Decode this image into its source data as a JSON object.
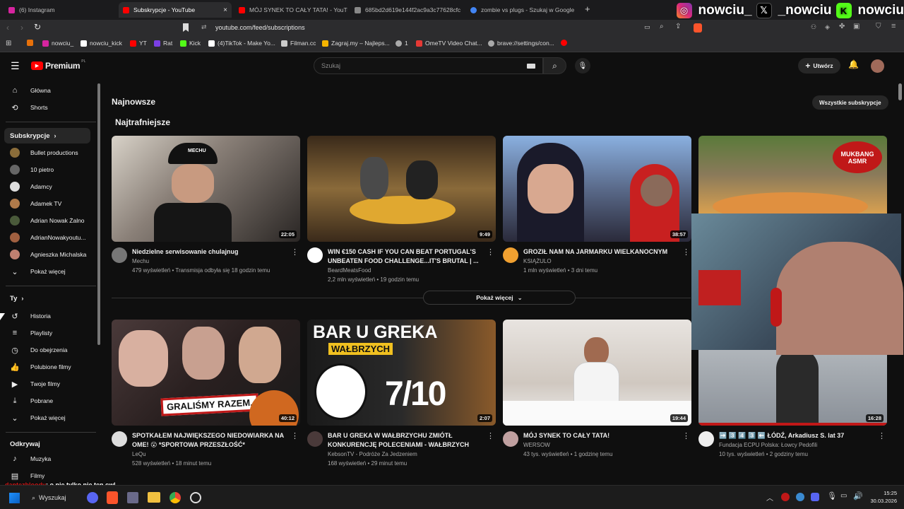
{
  "browser": {
    "tabs": [
      {
        "label": "(6) Instagram",
        "color": "#d6249f"
      },
      {
        "label": "Subskrypcje - YouTube",
        "color": "#ff0000",
        "close": "×"
      },
      {
        "label": "MÓJ SYNEK TO CAŁY TATA! - YouTube",
        "color": "#ff0000"
      },
      {
        "label": "685bd2d619e144f2ac9a3c77628cfc",
        "color": "#888888"
      },
      {
        "label": "zombie vs plugs - Szukaj w Google",
        "color": "#4285f4"
      }
    ],
    "new_tab": "+",
    "url": "youtube.com/feed/subscriptions",
    "bookmarks": [
      {
        "label": "",
        "color": "#e8710a"
      },
      {
        "label": "nowciu_",
        "color": "#d6249f"
      },
      {
        "label": "nowciu_kick",
        "color": "#ffffff"
      },
      {
        "label": "YT",
        "color": "#ff0000"
      },
      {
        "label": "Rat",
        "color": "#7b3fe4"
      },
      {
        "label": "Kick",
        "color": "#53fc18"
      },
      {
        "label": "(4)TikTok - Make Yo...",
        "color": "#ffffff"
      },
      {
        "label": "Filman.cc",
        "color": "#cccccc"
      },
      {
        "label": "Zagraj.my – Najleps...",
        "color": "#f4b400"
      },
      {
        "label": "1",
        "color": "#aaaaaa"
      },
      {
        "label": "OmeTV Video Chat...",
        "color": "#e53935"
      },
      {
        "label": "brave://settings/con...",
        "color": "#aaaaaa"
      }
    ]
  },
  "overlay": {
    "instagram": "nowciu_",
    "x": "_nowciu",
    "kick": "nowciu",
    "kick_letter": "K"
  },
  "youtube": {
    "logo": "Premium",
    "logo_sup": "PL",
    "search_placeholder": "Szukaj",
    "create_label": "Utwórz",
    "sidebar": {
      "main": [
        {
          "label": "Główna",
          "icon": "⌂"
        },
        {
          "label": "Shorts",
          "icon": "⟲"
        }
      ],
      "subs_header": "Subskrypcje",
      "subs": [
        {
          "label": "Bullet productions",
          "color": "#8b6d3a"
        },
        {
          "label": "10 pietro",
          "color": "#666666"
        },
        {
          "label": "Adamcy",
          "color": "#dddddd"
        },
        {
          "label": "Adamek TV",
          "color": "#b07a4a"
        },
        {
          "label": "Adrian Nowak Żalno",
          "color": "#4a5a3a"
        },
        {
          "label": "AdrianNowakyoutu...",
          "color": "#a06040"
        },
        {
          "label": "Agnieszka Michalska",
          "color": "#c08070"
        }
      ],
      "show_more": "Pokaż więcej",
      "you_header": "Ty",
      "you": [
        {
          "label": "Historia",
          "icon": "↺"
        },
        {
          "label": "Playlisty",
          "icon": "≡"
        },
        {
          "label": "Do obejrzenia",
          "icon": "◷"
        },
        {
          "label": "Polubione filmy",
          "icon": "👍"
        },
        {
          "label": "Twoje filmy",
          "icon": "▶"
        },
        {
          "label": "Pobrane",
          "icon": "⤓"
        }
      ],
      "show_more2": "Pokaż więcej",
      "explore_header": "Odkrywaj",
      "explore": [
        {
          "label": "Muzyka",
          "icon": "♪"
        },
        {
          "label": "Filmy",
          "icon": "▤"
        }
      ]
    },
    "section_title": "Najnowsze",
    "all_subs": "Wszystkie subskrypcje",
    "subsection_title": "Najtrafniejsze",
    "show_more_center": "Pokaż więcej",
    "videos": [
      {
        "title": "Niedzielne serwisowanie chulajnug",
        "channel": "Mechu",
        "meta": "479 wyświetleń • Transmisja odbyła się 18 godzin temu",
        "duration": "22:05",
        "thumb": "#5a5250",
        "avatar": "#777777"
      },
      {
        "title": "WIN €150 CASH IF YOU CAN BEAT PORTUGAL'S UNBEATEN FOOD CHALLENGE...IT'S BRUTAL | ...",
        "channel": "BeardMeatsFood",
        "meta": "2,2 mln wyświetleń • 19 godzin temu",
        "duration": "9:49",
        "thumb": "#6a4a2a",
        "avatar": "#ffffff"
      },
      {
        "title": "GROZIŁ NAM NA JARMARKU WIELKANOCNYM",
        "channel": "KSIĄŻULO",
        "meta": "1 mln wyświetleń • 3 dni temu",
        "duration": "38:57",
        "thumb": "#4a5a7a",
        "avatar": "#f0a030"
      },
      {
        "title": "",
        "channel": "",
        "meta": "",
        "duration": "",
        "thumb": "#7a6a4a",
        "avatar": ""
      },
      {
        "title": "SPOTKAŁEM NAJWIĘKSZEGO NIEDOWIARKA NA OME! 😮 *SPORTOWA PRZESZŁOŚĆ*",
        "channel": "LeQu",
        "meta": "528 wyświetleń • 18 minut temu",
        "duration": "40:12",
        "thumb": "#3a2a2a",
        "avatar": "#dddddd"
      },
      {
        "title": "BAR U GREKA W WAŁBRZYCHU ZMIÓTŁ KONKURENCJĘ POLECENIAMI - WAŁBRZYCH",
        "channel": "KebsonTV - Podróże Za Jedzeniem",
        "meta": "168 wyświetleń • 29 minut temu",
        "duration": "2:07",
        "thumb": "#2a2a2a",
        "avatar": "#4a3a3a"
      },
      {
        "title": "MÓJ SYNEK TO CAŁY TATA!",
        "channel": "WERSOW",
        "meta": "43 tys. wyświetleń • 1 godzinę temu",
        "duration": "19:44",
        "thumb": "#d8d0c8",
        "avatar": "#c0a0a0"
      },
      {
        "title": "➡️ 3️⃣ 4️⃣ 3️⃣ ⬅️ ŁÓDŹ, Arkadiusz S. lat 37",
        "channel": "Fundacja ECPU Polska: Łowcy Pedofili",
        "meta": "10 tys. wyświetleń • 2 godziny temu",
        "duration": "16:28",
        "thumb": "#5a6a7a",
        "avatar": "#eeeeee"
      }
    ],
    "thumb_text": {
      "mechu": "MECHU",
      "mukbang": "MUKBANG ASMR",
      "bar": "BAR U GREKA",
      "walbrzych": "WAŁBRZYCH",
      "score": "7/10",
      "grali": "GRALIŚMY RAZEM."
    }
  },
  "chat": {
    "user": "dantezbloody",
    "message": ": o nie tylko nie ten cwl"
  },
  "taskbar": {
    "search": "Wyszukaj",
    "time": "15:25",
    "date": "30.03.2026"
  }
}
